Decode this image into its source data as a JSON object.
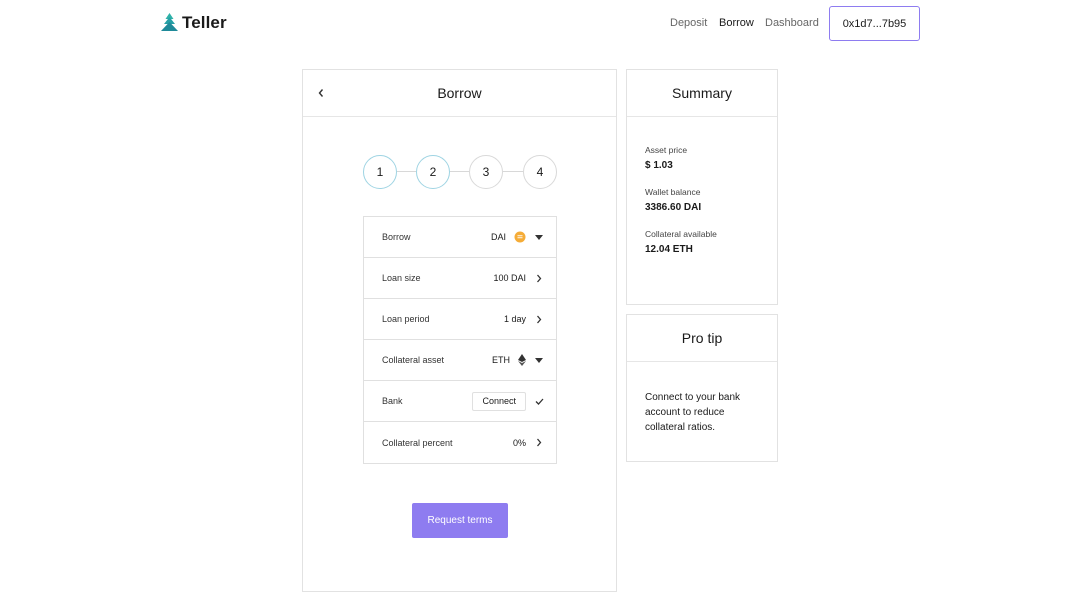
{
  "brand": {
    "name": "Teller"
  },
  "nav": {
    "deposit": "Deposit",
    "borrow": "Borrow",
    "dashboard": "Dashboard"
  },
  "wallet": {
    "address": "0x1d7...7b95"
  },
  "borrow_card": {
    "title": "Borrow",
    "steps": [
      "1",
      "2",
      "3",
      "4"
    ],
    "active_steps": 2,
    "rows": [
      {
        "label": "Borrow",
        "value": "DAI",
        "icon": "dai-coin-icon",
        "control": "dropdown"
      },
      {
        "label": "Loan size",
        "value": "100 DAI",
        "control": "chevron-right"
      },
      {
        "label": "Loan period",
        "value": "1 day",
        "control": "chevron-right"
      },
      {
        "label": "Collateral asset",
        "value": "ETH",
        "icon": "eth-icon",
        "control": "dropdown"
      },
      {
        "label": "Bank",
        "button": "Connect",
        "control": "check"
      },
      {
        "label": "Collateral percent",
        "value": "0%",
        "control": "chevron-right"
      }
    ],
    "submit_label": "Request terms"
  },
  "summary": {
    "title": "Summary",
    "items": [
      {
        "label": "Asset price",
        "value": "$ 1.03"
      },
      {
        "label": "Wallet balance",
        "value": "3386.60 DAI"
      },
      {
        "label": "Collateral available",
        "value": "12.04 ETH"
      }
    ]
  },
  "pro_tip": {
    "title": "Pro tip",
    "text": "Connect to your bank account to reduce collateral ratios."
  },
  "colors": {
    "accent": "#8e7cf0",
    "step_active": "#9fd4e3",
    "brand": "#2ba3a8",
    "dai": "#f5ac37"
  }
}
